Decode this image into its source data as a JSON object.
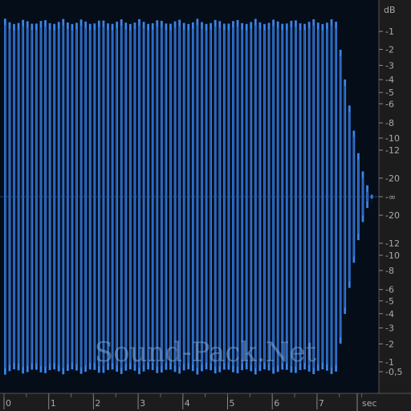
{
  "colors": {
    "background": "#000000",
    "plot_background": "#050d18",
    "waveform": "#3a84ea",
    "waveform_dark": "#1c4f9e",
    "ruler_background": "#1c1c1c",
    "ruler_text": "#a9a9a9",
    "watermark": "#7fa3d6"
  },
  "watermark": "Sound-Pack.Net",
  "level_ruler": {
    "unit": "dB",
    "labels": [
      "-1",
      "-2",
      "-3",
      "-4",
      "-5",
      "-6",
      "-8",
      "-10",
      "-12",
      "-20",
      "-∞",
      "-20",
      "-12",
      "-10",
      "-8",
      "-6",
      "-5",
      "-4",
      "-3",
      "-2",
      "-1",
      "-0,5"
    ],
    "amplitudes": [
      0.891,
      0.794,
      0.708,
      0.631,
      0.562,
      0.501,
      0.398,
      0.316,
      0.251,
      0.1,
      0,
      -0.1,
      -0.251,
      -0.316,
      -0.398,
      -0.501,
      -0.562,
      -0.631,
      -0.708,
      -0.794,
      -0.891,
      -0.944
    ]
  },
  "time_ruler": {
    "unit": "sec",
    "labels": [
      "0",
      "1",
      "2",
      "3",
      "4",
      "5",
      "6",
      "7"
    ],
    "values": [
      0,
      1,
      2,
      3,
      4,
      5,
      6,
      7
    ],
    "max_seconds": 8.25
  },
  "waveform": {
    "sustain_end_seconds": 7.42,
    "decay_end_seconds": 8.25,
    "peak_amplitude": 0.96,
    "cycles_per_second": 10
  }
}
